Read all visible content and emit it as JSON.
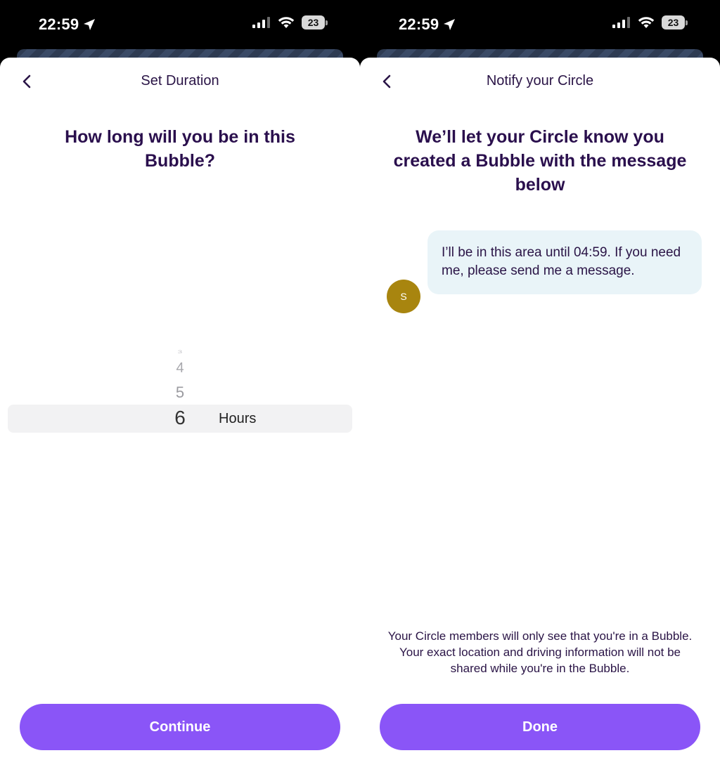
{
  "left_screen": {
    "status": {
      "time": "22:59",
      "battery": "23"
    },
    "nav": {
      "title": "Set Duration"
    },
    "headline": "How long will you be in this Bubble?",
    "picker": {
      "values": [
        "3",
        "4",
        "5",
        "6"
      ],
      "selected": "6",
      "unit": "Hours"
    },
    "primary_button": "Continue"
  },
  "right_screen": {
    "status": {
      "time": "22:59",
      "battery": "23"
    },
    "nav": {
      "title": "Notify your Circle"
    },
    "headline": "We’ll let your Circle know you created a Bubble with the message below",
    "avatar_initial": "S",
    "message": "I’ll be in this area until 04:59. If you need me, please send me a message.",
    "footnote": "Your Circle members will only see that you're in a Bubble. Your exact location and driving information will not be shared while you're in the Bubble.",
    "primary_button": "Done"
  },
  "colors": {
    "accent": "#8a55f7",
    "heading": "#2a0f4d",
    "message_bg": "#e9f4f8",
    "avatar_bg": "#a8850f"
  },
  "icons": [
    "location-arrow-icon",
    "cellular-signal-icon",
    "wifi-icon",
    "battery-icon",
    "back-chevron-icon"
  ]
}
